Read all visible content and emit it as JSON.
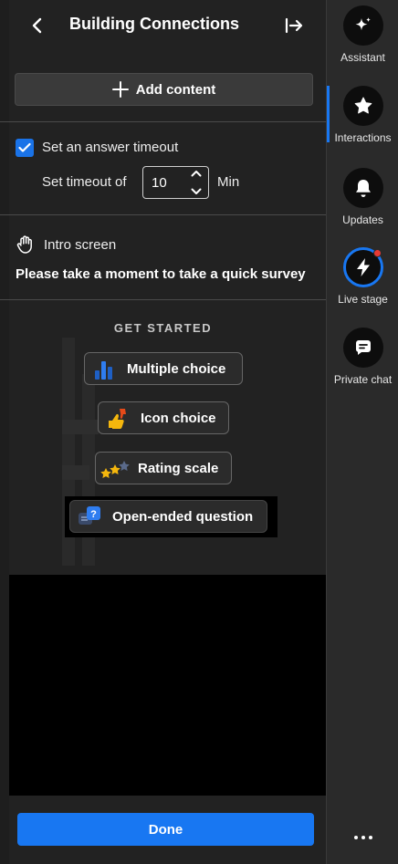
{
  "header": {
    "title": "Building Connections"
  },
  "add_content": {
    "label": "Add content"
  },
  "timeout": {
    "checkbox_label": "Set an answer timeout",
    "checked": true,
    "prefix": "Set timeout of",
    "value": "10",
    "unit": "Min"
  },
  "intro": {
    "label": "Intro screen",
    "text": "Please take a moment to take a quick survey"
  },
  "get_started": {
    "heading": "GET STARTED",
    "types": [
      {
        "label": "Multiple choice",
        "icon": "bar-chart-icon"
      },
      {
        "label": "Icon choice",
        "icon": "thumbs-icon"
      },
      {
        "label": "Rating scale",
        "icon": "stars-icon"
      },
      {
        "label": "Open-ended question",
        "icon": "question-bubble-icon"
      }
    ]
  },
  "done": {
    "label": "Done"
  },
  "rail": {
    "items": [
      {
        "label": "Assistant",
        "icon": "sparkle-icon"
      },
      {
        "label": "Interactions",
        "icon": "star-icon"
      },
      {
        "label": "Updates",
        "icon": "bell-icon"
      },
      {
        "label": "Live stage",
        "icon": "lightning-icon"
      },
      {
        "label": "Private chat",
        "icon": "chat-icon"
      }
    ],
    "active": "Interactions"
  },
  "colors": {
    "accent": "#1877f2",
    "notification": "#e53935",
    "panel": "#222222",
    "rail": "#2a2a2a"
  }
}
